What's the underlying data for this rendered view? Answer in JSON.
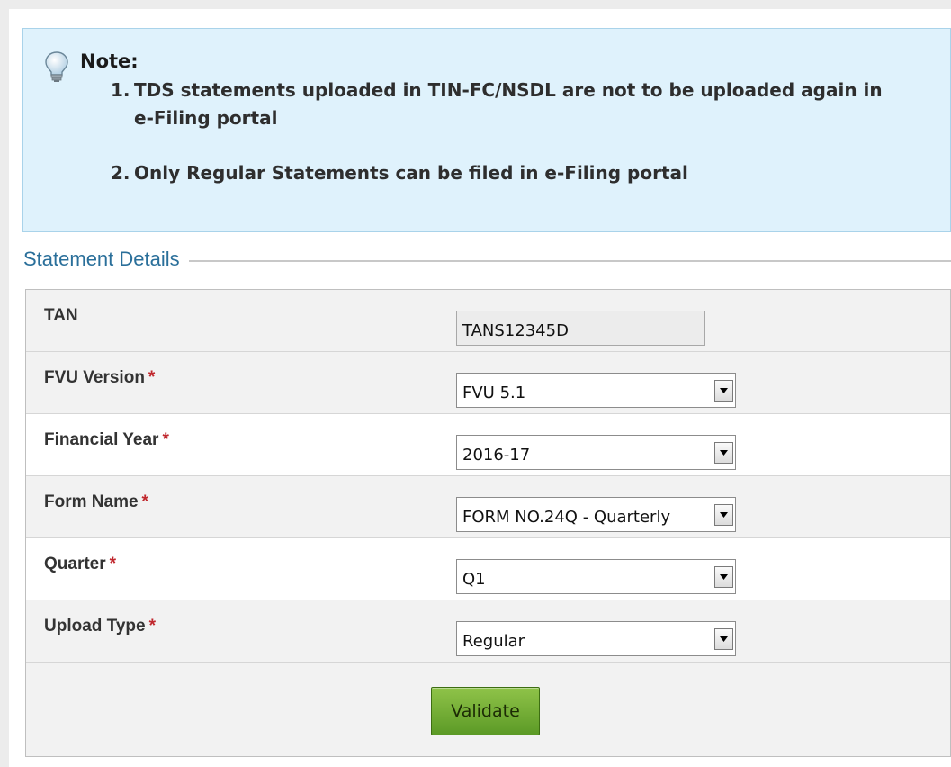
{
  "note": {
    "title": "Note:",
    "items": [
      {
        "num": "1.",
        "text": "TDS statements uploaded in TIN-FC/NSDL are not to be uploaded again in e-Filing portal"
      },
      {
        "num": "2.",
        "text": "Only Regular Statements can be filed in e-Filing portal"
      }
    ]
  },
  "section": {
    "legend": "Statement Details"
  },
  "form": {
    "required_marker": "*",
    "tan": {
      "label": "TAN",
      "value": "TANS12345D"
    },
    "fvu_version": {
      "label": "FVU Version",
      "value": "FVU 5.1"
    },
    "financial_year": {
      "label": "Financial Year",
      "value": "2016-17"
    },
    "form_name": {
      "label": "Form Name",
      "value": "FORM NO.24Q - Quarterly"
    },
    "quarter": {
      "label": "Quarter",
      "value": "Q1"
    },
    "upload_type": {
      "label": "Upload Type",
      "value": "Regular"
    },
    "validate_label": "Validate"
  },
  "icons": {
    "note": "lightbulb-icon",
    "dropdown": "chevron-down-icon"
  },
  "colors": {
    "note_bg": "#dff2fc",
    "legend_text": "#2a6f9a",
    "required": "#c0272d",
    "button": "#6fab31"
  }
}
